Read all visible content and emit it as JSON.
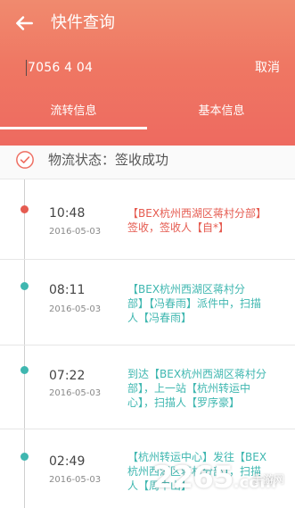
{
  "colors": {
    "header_gradient_top": "#f08a6e",
    "header_gradient_bottom": "#ee6a60",
    "accent_red": "#e55b50",
    "accent_teal": "#3fb7b0",
    "text_gray": "#555555"
  },
  "topbar": {
    "back_icon": "arrow-left-icon",
    "title": "快件查询"
  },
  "search": {
    "query": "7056 4 04",
    "cancel_label": "取消"
  },
  "tabs": [
    {
      "label": "流转信息",
      "active": true
    },
    {
      "label": "基本信息",
      "active": false
    }
  ],
  "status": {
    "icon": "check-circle-icon",
    "text": "物流状态：签收成功"
  },
  "timeline": [
    {
      "time": "10:48",
      "date": "2016-05-03",
      "lines": [
        "【BEX杭州西湖区蒋村分部】",
        "签收，签收人【自*】"
      ],
      "color": "#e55b50",
      "dot": "#e55b50"
    },
    {
      "time": "08:11",
      "date": "2016-05-03",
      "lines": [
        "【BEX杭州西湖区蒋村分",
        "部】【冯春雨】派件中，扫描",
        "人【冯春雨】"
      ],
      "color": "#3fb7b0",
      "dot": "#3fb7b0"
    },
    {
      "time": "07:22",
      "date": "2016-05-03",
      "lines": [
        "到达【BEX杭州西湖区蒋村分",
        "部】，上一站【杭州转运中",
        "心】，扫描人【罗序豪】"
      ],
      "color": "#3fb7b0",
      "dot": "#3fb7b0"
    },
    {
      "time": "02:49",
      "date": "2016-05-03",
      "lines": [
        "【杭州转运中心】发往【BEX",
        "杭州西湖区蒋村分部】，扫描",
        "人【周中山】"
      ],
      "color": "#3fb7b0",
      "dot": "#3fb7b0"
    }
  ],
  "watermark": {
    "main": "2265",
    "suffix": ".com",
    "sub": "手游网"
  }
}
